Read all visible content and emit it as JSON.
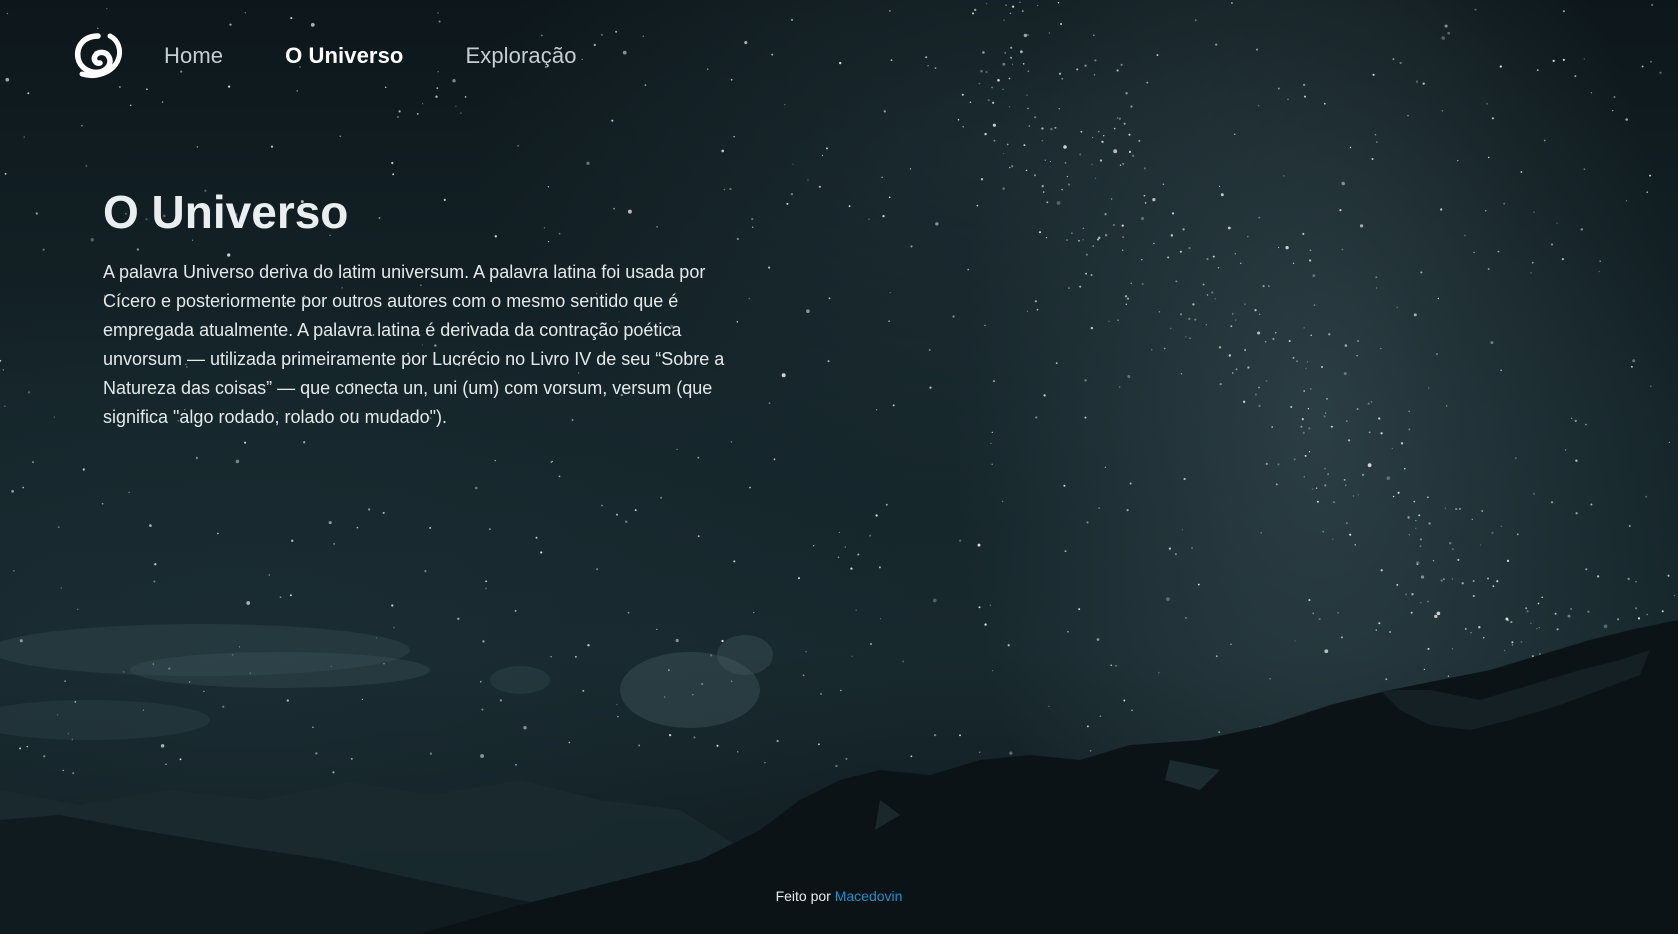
{
  "brand": {
    "logo_icon": "swirl-logo-icon"
  },
  "nav": {
    "items": [
      {
        "label": "Home",
        "active": false
      },
      {
        "label": "O Universo",
        "active": true
      },
      {
        "label": "Exploração",
        "active": false
      }
    ]
  },
  "main": {
    "title": "O Universo",
    "paragraph": "A palavra Universo deriva do latim universum. A palavra latina foi usada por Cícero e posteriormente por outros autores com o mesmo sentido que é empregada atualmente. A palavra latina é derivada da contração poética unvorsum — utilizada primeiramente por Lucrécio no Livro IV de seu “Sobre a Natureza das coisas” — que conecta un, uni (um) com vorsum, versum (que significa \"algo rodado, rolado ou mudado\")."
  },
  "footer": {
    "made_by": "Feito por",
    "author": "Macedovin"
  },
  "colors": {
    "background": "#0b1419",
    "text": "#e4e9ea",
    "link_accent": "#1f8fc9"
  }
}
